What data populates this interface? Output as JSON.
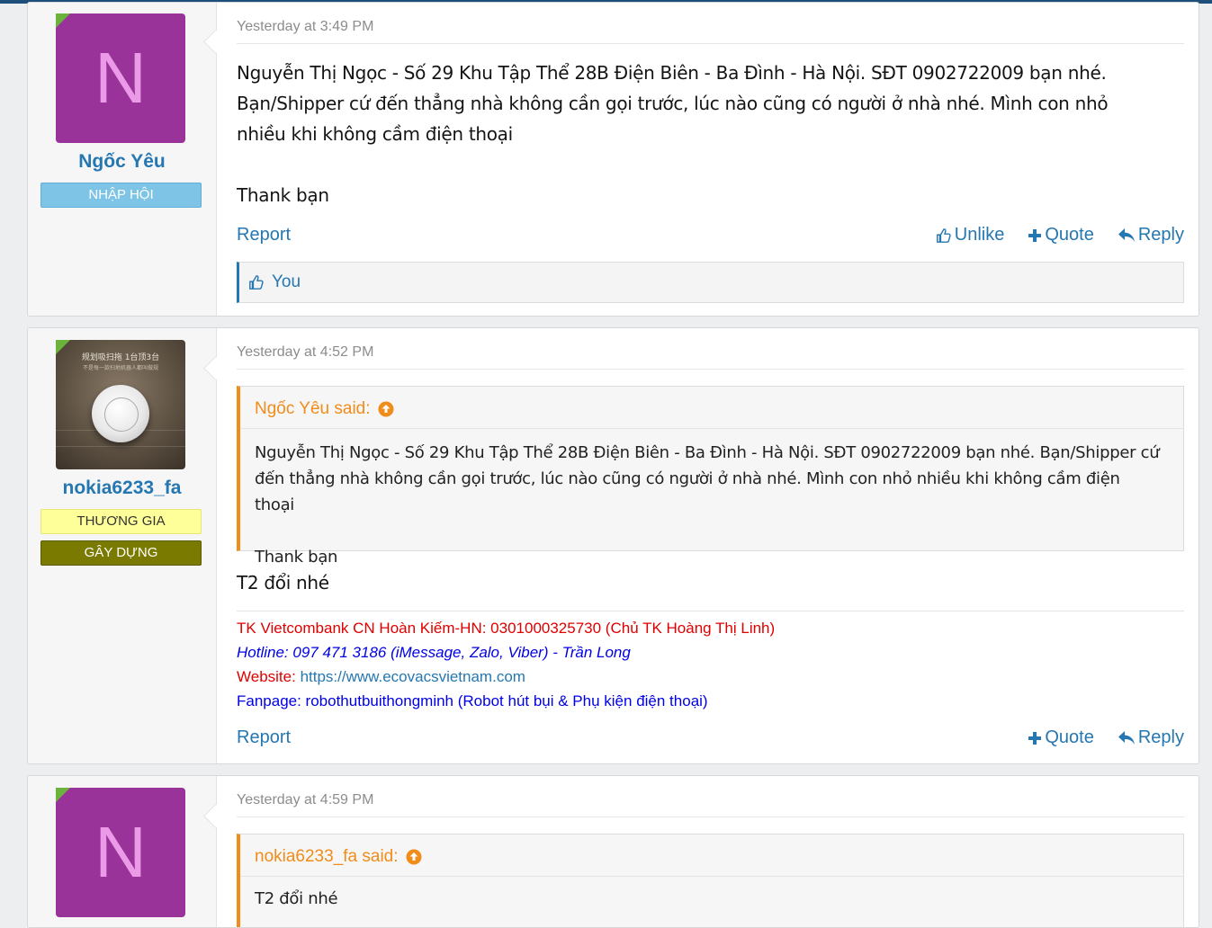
{
  "posts": [
    {
      "user": {
        "avatar_letter": "N",
        "name": "Ngốc Yêu",
        "badges": [
          "NHẬP HỘI"
        ]
      },
      "date": "Yesterday at 3:49 PM",
      "lines": [
        "Nguyễn Thị Ngọc - Số 29 Khu Tập Thể 28B Điện Biên - Ba Đình - Hà Nội. SĐT 0902722009 bạn nhé.",
        "Bạn/Shipper cứ đến thẳng nhà không cần gọi trước, lúc nào cũng có người ở nhà nhé. Mình con nhỏ",
        "nhiều khi không cầm điện thoại",
        "Thank bạn"
      ],
      "actions": {
        "report": "Report",
        "unlike": "Unlike",
        "quote": "Quote",
        "reply": "Reply"
      },
      "likes": "You"
    },
    {
      "user": {
        "name": "nokia6233_fa",
        "badges": [
          "THƯƠNG GIA",
          "GÂY DỰNG"
        ],
        "avatar_text1": "规划吸扫拖 1台顶3台",
        "avatar_text2": "不是每一款扫地机器人都叫做规"
      },
      "date": "Yesterday at 4:52 PM",
      "quote": {
        "author": "Ngốc Yêu said:",
        "lines": [
          "Nguyễn Thị Ngọc - Số 29 Khu Tập Thể 28B Điện Biên - Ba Đình - Hà Nội. SĐT 0902722009 bạn nhé. Bạn/Shipper cứ",
          "đến thẳng nhà không cần gọi trước, lúc nào cũng có người ở nhà nhé. Mình con nhỏ nhiều khi không cầm điện thoại",
          "Thank bạn"
        ]
      },
      "message": "T2 đổi nhé",
      "signature": {
        "bank": "TK Vietcombank CN Hoàn Kiếm-HN: 0301000325730 (Chủ TK Hoàng Thị Linh)",
        "hotline": "Hotline: 097 471 3186 (iMessage, Zalo, Viber) - Trần Long",
        "website_label": "Website: ",
        "website_url": "https://www.ecovacsvietnam.com",
        "fanpage": "Fanpage: robothutbuithongminh (Robot hút bụi & Phụ kiện điện thoại)"
      },
      "actions": {
        "report": "Report",
        "quote": "Quote",
        "reply": "Reply"
      }
    },
    {
      "user": {
        "avatar_letter": "N"
      },
      "date": "Yesterday at 4:59 PM",
      "quote": {
        "author": "nokia6233_fa said:",
        "lines": [
          "T2 đổi nhé"
        ]
      }
    }
  ],
  "colors": {
    "accent": "#2577b1",
    "quote_accent": "#f08c1a",
    "avatar_purple": "#993399",
    "online_green": "#6cb33e"
  }
}
